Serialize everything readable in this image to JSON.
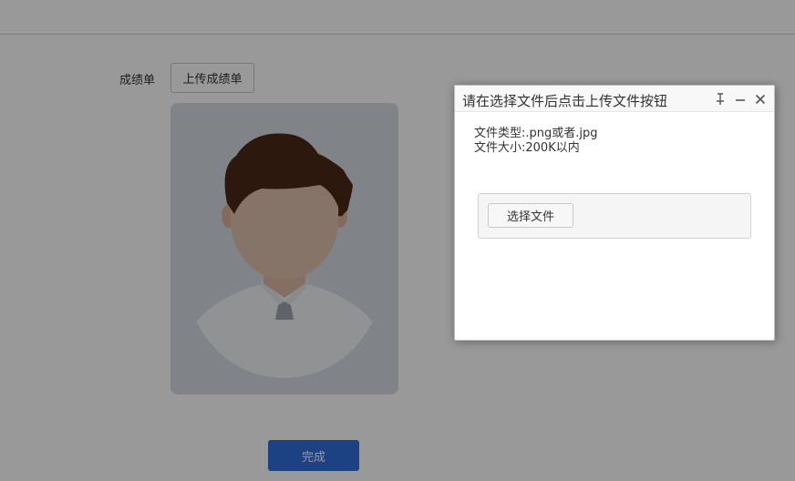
{
  "form": {
    "transcript_label": "成绩单",
    "upload_button": "上传成绩单",
    "done_button": "完成"
  },
  "dialog": {
    "title": "请在选择文件后点击上传文件按钮",
    "file_type_text": "文件类型:.png或者.jpg",
    "file_size_text": "文件大小:200K以内",
    "choose_file_button": "选择文件"
  },
  "icons": {
    "pin": "pin-icon",
    "minimize": "minimize-icon",
    "close": "close-icon",
    "avatar": "avatar-placeholder"
  },
  "colors": {
    "primary": "#2f6fdd",
    "overlay": "rgba(0,0,0,0.4)",
    "photo_background": "#d6dce5"
  }
}
